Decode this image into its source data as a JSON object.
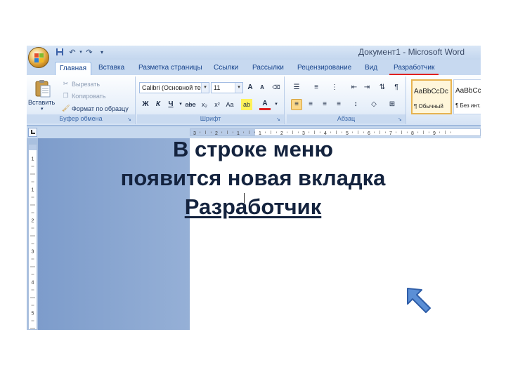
{
  "window": {
    "title": "Документ1 - Microsoft Word"
  },
  "quick_access": {
    "icons": [
      "save-icon",
      "undo-icon",
      "redo-icon",
      "customize-icon"
    ]
  },
  "tabs": [
    {
      "label": "Главная",
      "active": true
    },
    {
      "label": "Вставка",
      "active": false
    },
    {
      "label": "Разметка страницы",
      "active": false
    },
    {
      "label": "Ссылки",
      "active": false
    },
    {
      "label": "Рассылки",
      "active": false
    },
    {
      "label": "Рецензирование",
      "active": false
    },
    {
      "label": "Вид",
      "active": false
    },
    {
      "label": "Разработчик",
      "active": false,
      "highlight_color": "#e02020"
    }
  ],
  "ribbon": {
    "clipboard": {
      "group_label": "Буфер обмена",
      "paste_label": "Вставить",
      "cut_label": "Вырезать",
      "copy_label": "Копировать",
      "format_painter_label": "Формат по образцу"
    },
    "font": {
      "group_label": "Шрифт",
      "font_name": "Calibri (Основной текст)",
      "font_size": "11",
      "bold": "Ж",
      "italic": "К",
      "underline": "Ч",
      "strikethrough": "abe",
      "subscript": "x₂",
      "superscript": "x²",
      "change_case": "Aa",
      "grow_font": "A",
      "shrink_font": "A",
      "font_color": "A",
      "highlight": "ab"
    },
    "paragraph": {
      "group_label": "Абзац",
      "pilcrow": "¶"
    },
    "styles": {
      "items": [
        {
          "sample": "AaBbCcDc",
          "name": "¶ Обычный"
        },
        {
          "sample": "AaBbCcDc",
          "name": "¶ Без инт..."
        }
      ]
    }
  },
  "ruler": {
    "h_labels": [
      "3",
      "2",
      "1",
      "1",
      "2",
      "3",
      "4",
      "5",
      "6",
      "7",
      "8",
      "9"
    ],
    "v_labels": [
      "1",
      "1",
      "2",
      "3",
      "4",
      "5"
    ]
  },
  "caption": {
    "line1": "В строке меню",
    "line2": "появится новая вкладка",
    "line3": "Разработчик"
  },
  "colors": {
    "ribbon_tab_text": "#15428b",
    "dev_tab_underline": "#e02020",
    "arrow": "#5b8fd6"
  }
}
